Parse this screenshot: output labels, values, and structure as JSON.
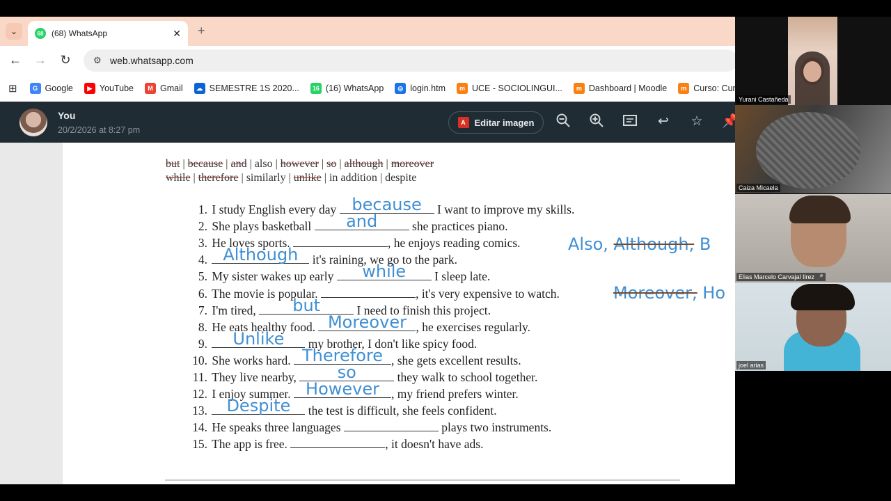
{
  "browser": {
    "tab_title": "(68) WhatsApp",
    "tab_badge": "68",
    "url": "web.whatsapp.com",
    "bookmarks": [
      {
        "label": "Google",
        "icon": "google-icon",
        "color": "#4285f4",
        "glyph": "G"
      },
      {
        "label": "YouTube",
        "icon": "youtube-icon",
        "color": "#ff0000",
        "glyph": "▶"
      },
      {
        "label": "Gmail",
        "icon": "gmail-icon",
        "color": "#ea4335",
        "glyph": "M"
      },
      {
        "label": "SEMESTRE 1S 2020...",
        "icon": "onedrive-icon",
        "color": "#0a64d6",
        "glyph": "☁"
      },
      {
        "label": "(16) WhatsApp",
        "icon": "whatsapp-icon",
        "color": "#25d366",
        "glyph": "16"
      },
      {
        "label": "login.htm",
        "icon": "globe-icon",
        "color": "#1a73e8",
        "glyph": "◎"
      },
      {
        "label": "UCE - SOCIOLINGUI...",
        "icon": "moodle-icon",
        "color": "#f98012",
        "glyph": "m"
      },
      {
        "label": "Dashboard | Moodle",
        "icon": "moodle-icon",
        "color": "#f98012",
        "glyph": "m"
      },
      {
        "label": "Curso: Curso Ab",
        "icon": "moodle-icon",
        "color": "#f98012",
        "glyph": "m"
      }
    ]
  },
  "viewer": {
    "sender": "You",
    "timestamp": "20/2/2026 at 8:27 pm",
    "edit_label": "Editar imagen",
    "pdf_glyph": "A"
  },
  "document": {
    "wordbank_line1": [
      "but",
      "because",
      "and",
      "also",
      "however",
      "so",
      "although",
      "moreover"
    ],
    "wordbank_line2": [
      "while",
      "therefore",
      "similarly",
      "unlike",
      "in addition",
      "despite"
    ],
    "exercises": [
      {
        "n": "1.",
        "before": "I study English every day",
        "answer": "because",
        "after": "I want to improve my skills."
      },
      {
        "n": "2.",
        "before": "She plays basketball",
        "answer": "and",
        "after": "she practices piano."
      },
      {
        "n": "3.",
        "before": "He loves sports.",
        "answer": "",
        "after": ", he enjoys reading comics."
      },
      {
        "n": "4.",
        "before": "",
        "answer": "Although",
        "after": "it's raining, we go to the park."
      },
      {
        "n": "5.",
        "before": "My sister wakes up early",
        "answer": "while",
        "after": "I sleep late."
      },
      {
        "n": "6.",
        "before": "The movie is popular.",
        "answer": "",
        "after": ", it's very expensive to watch."
      },
      {
        "n": "7.",
        "before": "I'm tired,",
        "answer": "but",
        "after": "I need to finish this project."
      },
      {
        "n": "8.",
        "before": "He eats healthy food.",
        "answer": "Moreover",
        "after": ", he exercises regularly."
      },
      {
        "n": "9.",
        "before": "",
        "answer": "Unlike",
        "after": "my brother, I don't like spicy food."
      },
      {
        "n": "10.",
        "before": "She works hard.",
        "answer": "Therefore",
        "after": ", she gets excellent results."
      },
      {
        "n": "11.",
        "before": "They live nearby,",
        "answer": "so",
        "after": "they walk to school together."
      },
      {
        "n": "12.",
        "before": "I enjoy summer.",
        "answer": "However",
        "after": ", my friend prefers winter."
      },
      {
        "n": "13.",
        "before": "",
        "answer": "Despite",
        "after": "the test is difficult, she feels confident."
      },
      {
        "n": "14.",
        "before": "He speaks three languages",
        "answer": "",
        "after": "plays two instruments."
      },
      {
        "n": "15.",
        "before": "The app is free.",
        "answer": "",
        "after": ", it doesn't have ads."
      }
    ],
    "side_note_3": {
      "a": "Also,",
      "b": "Although,",
      "c": "B"
    },
    "side_note_6": {
      "a": "Moreover,",
      "b": "Ho"
    }
  },
  "participants": [
    {
      "name": "Yurani Castañeda"
    },
    {
      "name": "Caiza Micaela"
    },
    {
      "name": "Elias Marcelo Carvajal Ilrez"
    },
    {
      "name": "joel arias"
    }
  ],
  "colors": {
    "answer_blue": "#3f8fd3",
    "whatsapp_green": "#25d366",
    "viewer_header": "#202c33"
  }
}
